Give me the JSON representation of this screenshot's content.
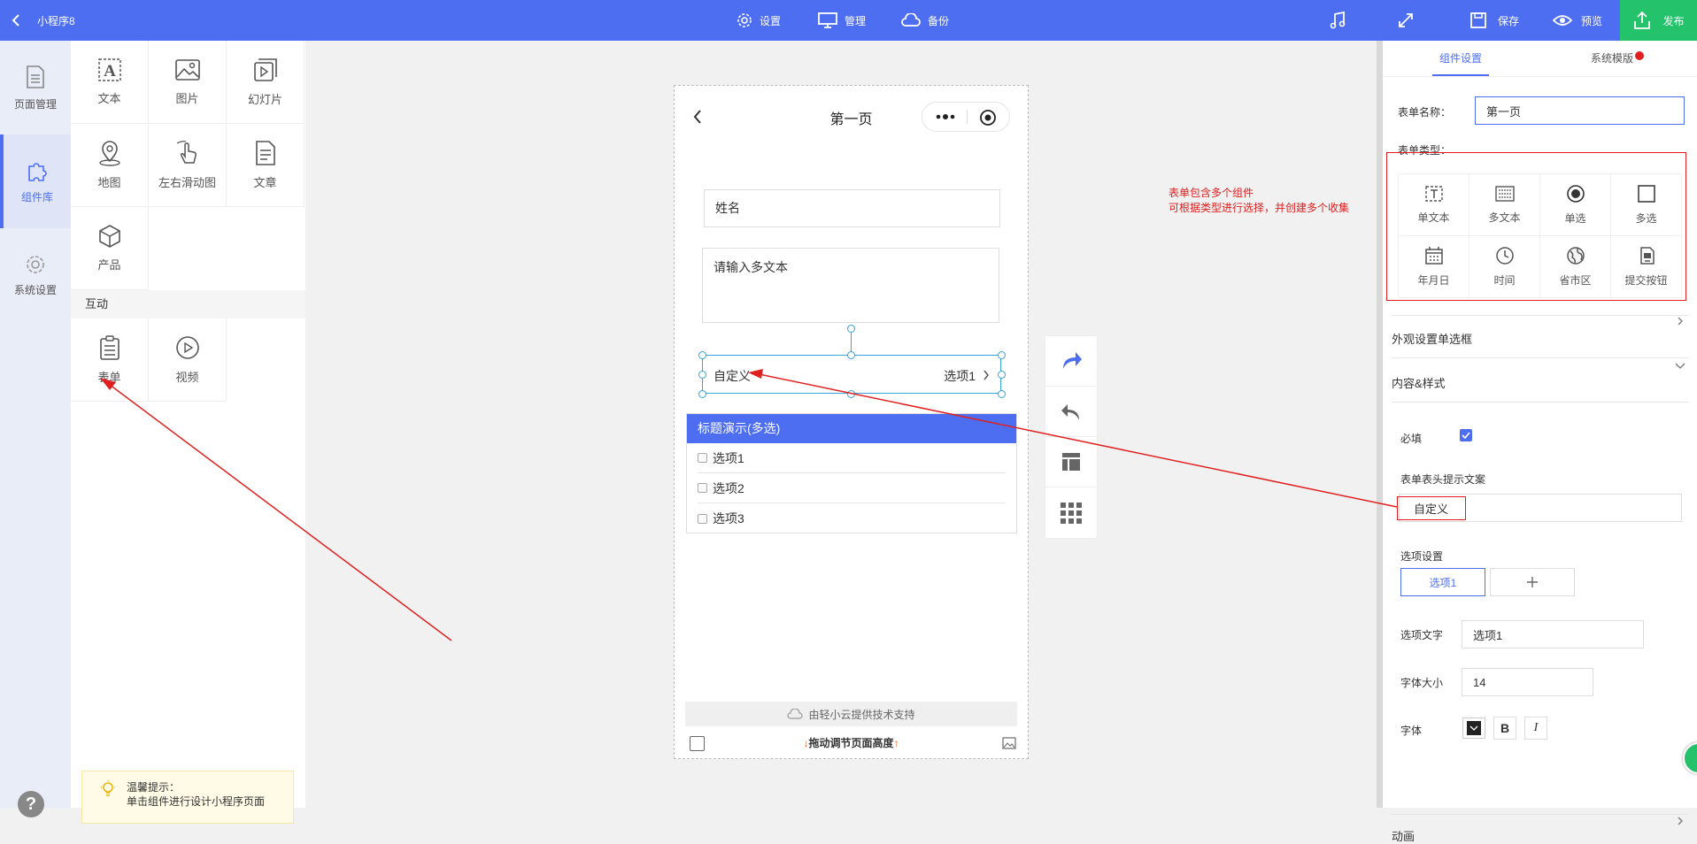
{
  "topbar": {
    "title": "小程序8",
    "settings": "设置",
    "manage": "管理",
    "backup": "备份",
    "save": "保存",
    "preview": "预览",
    "publish": "发布"
  },
  "leftnav": {
    "items": [
      {
        "label": "页面管理",
        "icon": "page-icon"
      },
      {
        "label": "组件库",
        "icon": "puzzle-icon"
      },
      {
        "label": "系统设置",
        "icon": "gear-icon"
      }
    ]
  },
  "components": {
    "basic": [
      {
        "label": "文本",
        "icon": "text-icon"
      },
      {
        "label": "图片",
        "icon": "image-icon"
      },
      {
        "label": "幻灯片",
        "icon": "slideshow-icon"
      },
      {
        "label": "地图",
        "icon": "map-pin-icon"
      },
      {
        "label": "左右滑动图",
        "icon": "swipe-hand-icon"
      },
      {
        "label": "文章",
        "icon": "article-icon"
      },
      {
        "label": "产品",
        "icon": "box-icon"
      }
    ],
    "interact_title": "互动",
    "interact": [
      {
        "label": "表单",
        "icon": "clipboard-icon"
      },
      {
        "label": "视频",
        "icon": "play-circle-icon"
      }
    ],
    "tip_title": "温馨提示：",
    "tip_text": "单击组件进行设计小程序页面"
  },
  "phone": {
    "page_title": "第一页",
    "name_field": "姓名",
    "textarea_placeholder": "请输入多文本",
    "custom_label": "自定义",
    "custom_value": "选项1",
    "multi_title": "标题演示(多选)",
    "options": [
      "选项1",
      "选项2",
      "选项3"
    ],
    "support": "由轻小云提供技术支持",
    "drag_hint": "拖动调节页面高度"
  },
  "annotation": {
    "line1": "表单包含多个组件",
    "line2": "可根据类型进行选择，并创建多个收集"
  },
  "rightpanel": {
    "tab_component": "组件设置",
    "tab_template": "系统模版",
    "form_name_label": "表单名称：",
    "form_name_value": "第一页",
    "form_type_label": "表单类型：",
    "types": [
      {
        "label": "单文本",
        "icon": "single-text-icon"
      },
      {
        "label": "多文本",
        "icon": "multi-text-icon"
      },
      {
        "label": "单选",
        "icon": "radio-icon"
      },
      {
        "label": "多选",
        "icon": "checkbox-icon"
      },
      {
        "label": "年月日",
        "icon": "calendar-icon"
      },
      {
        "label": "时间",
        "icon": "clock-icon"
      },
      {
        "label": "省市区",
        "icon": "globe-icon"
      },
      {
        "label": "提交按钮",
        "icon": "submit-icon"
      }
    ],
    "appearance": "外观设置单选框",
    "content_style": "内容&样式",
    "required": "必填",
    "header_hint": "表单表头提示文案",
    "header_hint_value": "自定义",
    "option_settings": "选项设置",
    "option_tab": "选项1",
    "option_text_label": "选项文字",
    "option_text_value": "选项1",
    "font_size_label": "字体大小",
    "font_size_value": "14",
    "font_label": "字体",
    "bold": "B",
    "italic": "I",
    "animation": "动画"
  },
  "colors": {
    "primary": "#4e6ef2",
    "publish": "#23c26b",
    "annotation": "#e02020"
  }
}
